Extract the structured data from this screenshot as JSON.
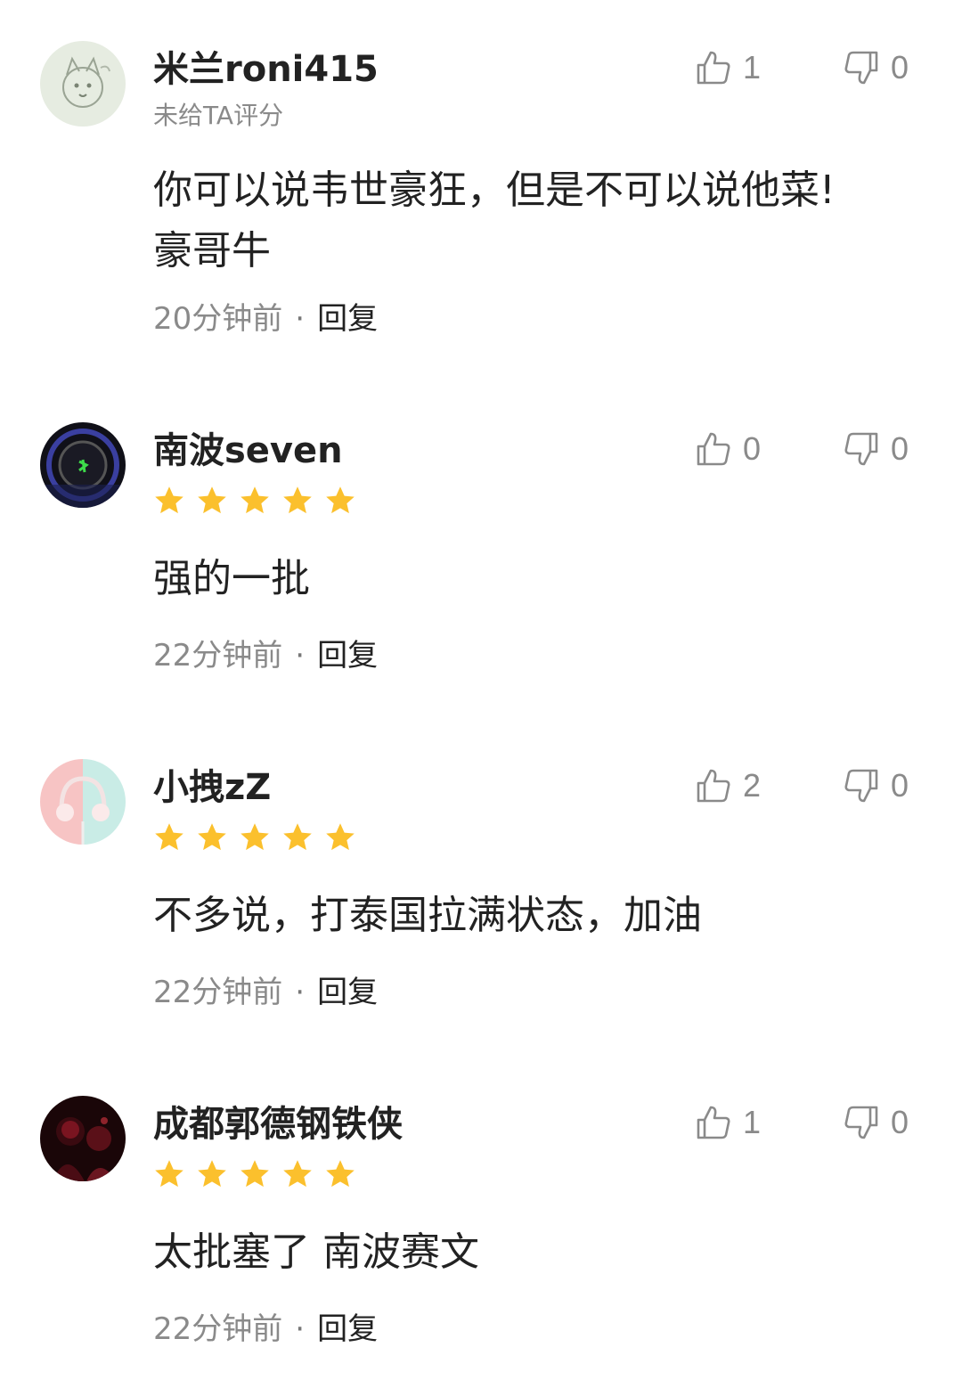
{
  "comments": [
    {
      "username": "米兰roni415",
      "rating_text": "未给TA评分",
      "stars": 0,
      "content_lines": [
        "你可以说韦世豪狂，但是不可以说他菜!",
        "豪哥牛"
      ],
      "time": "20分钟前",
      "reply_label": "回复",
      "likes": "1",
      "dislikes": "0",
      "avatar_icon": "sketch-fox-avatar"
    },
    {
      "username": "南波seven",
      "stars": 5,
      "content_lines": [
        "强的一批"
      ],
      "time": "22分钟前",
      "reply_label": "回复",
      "likes": "0",
      "dislikes": "0",
      "avatar_icon": "headphones-dark-avatar"
    },
    {
      "username": "小拽zZ",
      "stars": 5,
      "content_lines": [
        "不多说，打泰国拉满状态，加油"
      ],
      "time": "22分钟前",
      "reply_label": "回复",
      "likes": "2",
      "dislikes": "0",
      "avatar_icon": "headphones-pastel-avatar"
    },
    {
      "username": "成都郭德钢铁侠",
      "stars": 5,
      "content_lines": [
        "太批塞了 南波赛文"
      ],
      "time": "22分钟前",
      "reply_label": "回复",
      "likes": "1",
      "dislikes": "0",
      "avatar_icon": "red-figure-avatar"
    }
  ],
  "colors": {
    "star": "#FBC02D",
    "muted": "#8a8a8a",
    "text": "#222222"
  }
}
